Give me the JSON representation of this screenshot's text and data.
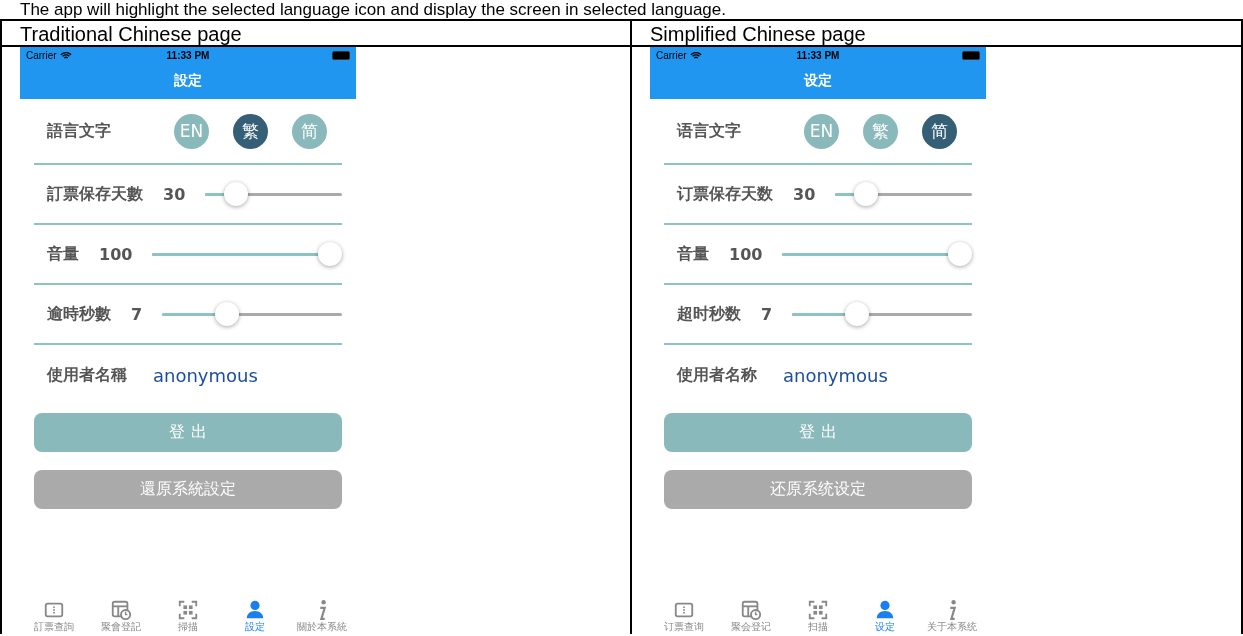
{
  "intro": "The app will highlight the selected language icon and display the screen in selected language.",
  "panels": [
    {
      "heading": "Traditional Chinese page",
      "phone": {
        "status": {
          "carrier": "Carrier",
          "time": "11:33 PM"
        },
        "title": "設定",
        "language": {
          "label": "語言文字",
          "options": [
            {
              "label": "EN",
              "selected": false
            },
            {
              "label": "繁",
              "selected": true
            },
            {
              "label": "简",
              "selected": false
            }
          ]
        },
        "sliders": [
          {
            "label": "訂票保存天數",
            "reading": "30",
            "level": 0.17
          },
          {
            "label": "音量",
            "reading": "100",
            "level": 1
          },
          {
            "label": "逾時秒數",
            "reading": "7",
            "level": 0.34
          }
        ],
        "username": {
          "label": "使用者名稱",
          "value": "anonymous"
        },
        "buttons": [
          {
            "label": "登 出",
            "kind": "primary"
          },
          {
            "label": "還原系統設定",
            "kind": "secondary"
          }
        ],
        "tabs": [
          {
            "label": "訂票查詢",
            "selected": false
          },
          {
            "label": "聚會登記",
            "selected": false
          },
          {
            "label": "掃描",
            "selected": false
          },
          {
            "label": "設定",
            "selected": true
          },
          {
            "label": "關於本系統",
            "selected": false
          }
        ]
      }
    },
    {
      "heading": "Simplified Chinese page",
      "phone": {
        "status": {
          "carrier": "Carrier",
          "time": "11:33 PM"
        },
        "title": "设定",
        "language": {
          "label": "语言文字",
          "options": [
            {
              "label": "EN",
              "selected": false
            },
            {
              "label": "繁",
              "selected": false
            },
            {
              "label": "简",
              "selected": true
            }
          ]
        },
        "sliders": [
          {
            "label": "订票保存天数",
            "reading": "30",
            "level": 0.17
          },
          {
            "label": "音量",
            "reading": "100",
            "level": 1
          },
          {
            "label": "超时秒数",
            "reading": "7",
            "level": 0.34
          }
        ],
        "username": {
          "label": "使用者名称",
          "value": "anonymous"
        },
        "buttons": [
          {
            "label": "登 出",
            "kind": "primary"
          },
          {
            "label": "还原系统设定",
            "kind": "secondary"
          }
        ],
        "tabs": [
          {
            "label": "订票查询",
            "selected": false
          },
          {
            "label": "聚会登记",
            "selected": false
          },
          {
            "label": "扫描",
            "selected": false
          },
          {
            "label": "设定",
            "selected": true
          },
          {
            "label": "关于本系统",
            "selected": false
          }
        ]
      }
    }
  ]
}
